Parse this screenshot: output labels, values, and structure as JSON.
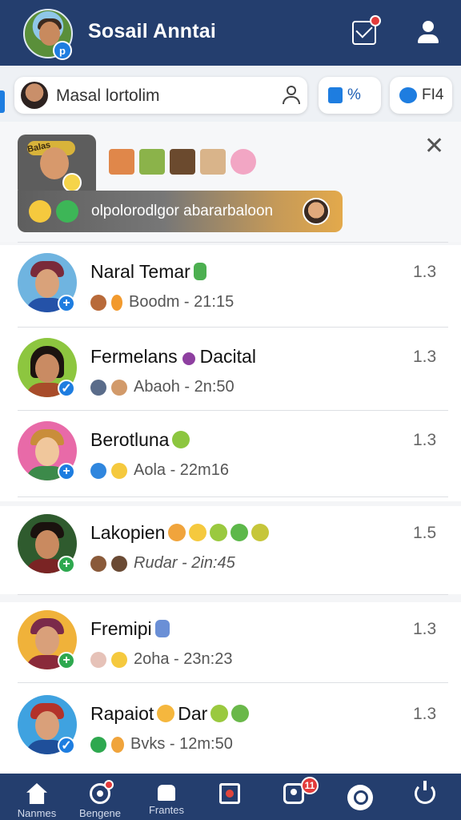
{
  "header": {
    "title": "Sosail Anntai",
    "avatar_badge": "p"
  },
  "search": {
    "value": "Masal lortolim",
    "pill1_label": "%",
    "pill2_label": "FI4"
  },
  "story": {
    "bubble_text": "Balas",
    "banner_text": "olpolorodlgor abararbaloon"
  },
  "chats": [
    {
      "name": "Naral Temar",
      "preview": "Boodm - 21:15",
      "time": "1.3",
      "plus_color": "#1e7de0"
    },
    {
      "name": "Fermelans",
      "name_suffix": "Dacital",
      "preview": "Abaoh - 2n:50",
      "time": "1.3",
      "plus_color": "#1e7de0"
    },
    {
      "name": "Berotluna",
      "preview": "Aola - 22m16",
      "time": "1.3",
      "plus_color": "#1e7de0"
    },
    {
      "name": "Lakopien",
      "preview": "Rudar - 2in:45",
      "time": "1.5",
      "plus_color": "#2ea84f"
    },
    {
      "name": "Fremipi",
      "preview": "2oha - 23n:23",
      "time": "1.3",
      "plus_color": "#2ea84f"
    },
    {
      "name": "Rapaiot",
      "name_suffix": "Dar",
      "preview": "Bvks - 12m:50",
      "time": "1.3",
      "plus_color": "#1e7de0"
    }
  ],
  "nav": {
    "home": "Nanmes",
    "radar": "Bengene",
    "flag": "Frantes",
    "group_badge": "11"
  },
  "colors": {
    "header_bg": "#243e6e",
    "accent": "#1e7de0",
    "notify": "#e23b3b"
  }
}
